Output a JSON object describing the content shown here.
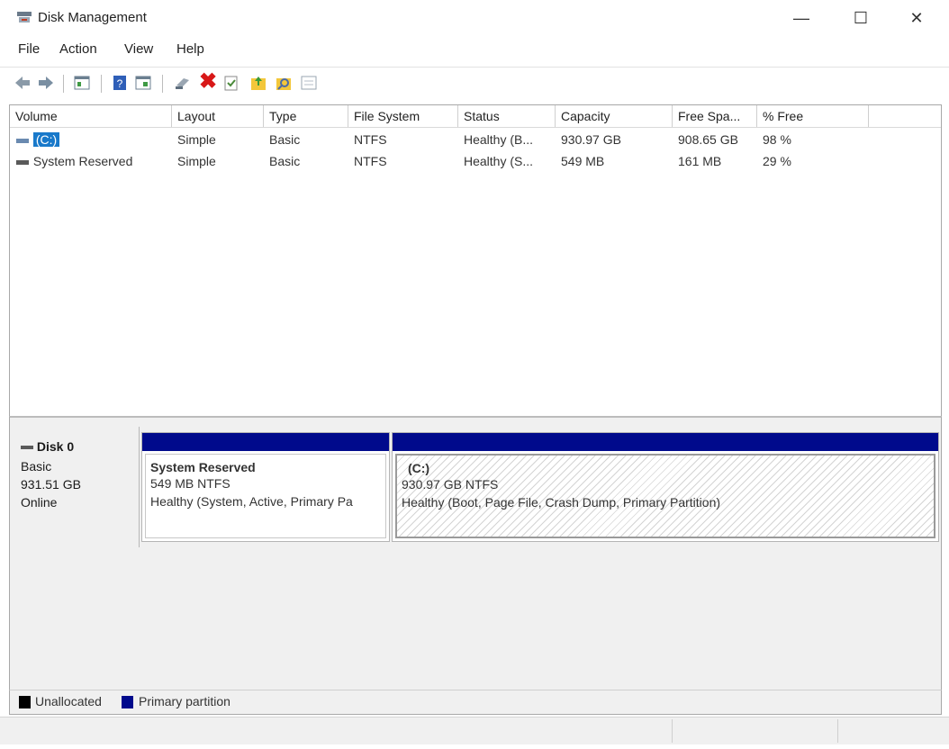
{
  "window": {
    "title": "Disk Management",
    "minimize_glyph": "—",
    "maximize_glyph": "☐",
    "close_glyph": "✕"
  },
  "menu": [
    "File",
    "Action",
    "View",
    "Help"
  ],
  "toolbar": {
    "icons": [
      "back-arrow-icon",
      "forward-arrow-icon",
      "console-tree-icon",
      "help-icon",
      "properties-view-icon",
      "connect-icon",
      "delete-icon",
      "check-icon",
      "folder-up-icon",
      "search-icon",
      "details-icon"
    ],
    "delete_glyph": "✖"
  },
  "volumes": {
    "columns": [
      "Volume",
      "Layout",
      "Type",
      "File System",
      "Status",
      "Capacity",
      "Free Spa...",
      "% Free"
    ],
    "rows": [
      [
        "(C:)",
        "Simple",
        "Basic",
        "NTFS",
        "Healthy (B...",
        "930.97 GB",
        "908.65 GB",
        "98 %"
      ],
      [
        "System Reserved",
        "Simple",
        "Basic",
        "NTFS",
        "Healthy (S...",
        "549 MB",
        "161 MB",
        "29 %"
      ]
    ],
    "selected_row": 0
  },
  "disk": {
    "name": "Disk 0",
    "type": "Basic",
    "size": "931.51 GB",
    "state": "Online",
    "partitions": [
      {
        "name": "System Reserved",
        "size": "549 MB NTFS",
        "status": "Healthy (System, Active, Primary Pa"
      },
      {
        "name": "(C:)",
        "size": "930.97 GB NTFS",
        "status": "Healthy (Boot, Page File, Crash Dump, Primary Partition)"
      }
    ]
  },
  "legend": {
    "unallocated": {
      "label": "Unallocated",
      "color": "#000000"
    },
    "primary": {
      "label": "Primary partition",
      "color": "#000a8c"
    }
  },
  "colors": {
    "selection": "#1979ca",
    "partition_bar": "#000a8c"
  }
}
